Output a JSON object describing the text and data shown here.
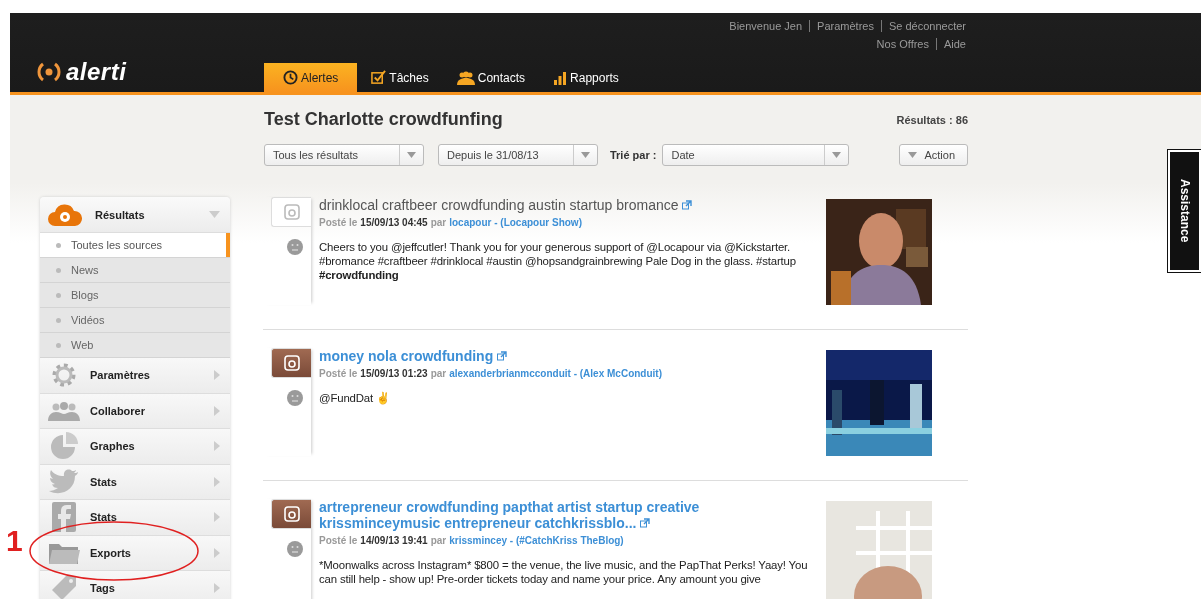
{
  "header": {
    "logo": "alerti",
    "user_links": [
      [
        "Bienvenue Jen",
        "Paramètres",
        "Se déconnecter"
      ],
      [
        "Nos Offres",
        "Aide"
      ]
    ],
    "tabs": [
      {
        "label": "Alertes",
        "selected": true
      },
      {
        "label": "Tâches",
        "selected": false
      },
      {
        "label": "Contacts",
        "selected": false
      },
      {
        "label": "Rapports",
        "selected": false
      }
    ]
  },
  "toolbar": {
    "title": "Test Charlotte crowdfunfing",
    "results": "Résultats : 86",
    "filters": [
      {
        "value": "Tous les résultats"
      },
      {
        "value": "Depuis le 31/08/13"
      }
    ],
    "sort_label": "Trié par :",
    "sort": {
      "value": "Date"
    },
    "action": "Action"
  },
  "sidebar": {
    "header": "Résultats",
    "sources": [
      {
        "label": "Toutes les sources",
        "selected": true
      },
      {
        "label": "News",
        "selected": false
      },
      {
        "label": "Blogs",
        "selected": false
      },
      {
        "label": "Vidéos",
        "selected": false
      },
      {
        "label": "Web",
        "selected": false
      }
    ],
    "items": [
      {
        "label": "Paramètres"
      },
      {
        "label": "Collaborer"
      },
      {
        "label": "Graphes"
      },
      {
        "label": "Stats"
      },
      {
        "label": "Stats"
      },
      {
        "label": "Exports"
      },
      {
        "label": "Tags"
      }
    ]
  },
  "posts": [
    {
      "title": "drinklocal craftbeer crowdfunding austin startup bromance",
      "read": true,
      "posted_label": "Posté le",
      "date": "15/09/13 04:45",
      "by_label": "par",
      "author": "locapour - (Locapour Show)",
      "body": [
        {
          "text": "Cheers to you @jeffcutler! Thank you for your generous support of @Locapour via @Kickstarter. #bromance #craftbeer #drinklocal #austin @hopsandgrainbrewing Pale Dog in the glass. #startup ",
          "bold": false
        },
        {
          "text": "#crowdfunding",
          "bold": true
        }
      ],
      "picture": {
        "kind": "picture"
      }
    },
    {
      "title": "money nola crowdfunding",
      "read": false,
      "posted_label": "Posté le",
      "date": "15/09/13 01:23",
      "by_label": "par",
      "author": "alexanderbrianmcconduit - (Alex McConduit)",
      "body": [
        {
          "text": "@FundDat ✌",
          "bold": false
        }
      ],
      "picture": {
        "kind": "picture"
      }
    },
    {
      "title": "artrepreneur crowdfunding papthat artist startup creative krissminceymusic entrepreneur catchkrissblo...",
      "read": false,
      "posted_label": "Posté le",
      "date": "14/09/13 19:41",
      "by_label": "par",
      "author": "krissmincey - (#CatchKriss TheBlog)",
      "body": [
        {
          "text": "*Moonwalks across Instagram* $800 = the venue, the live music, and the PapThat Perks! Yaay! You can still help - show up! Pre-order tickets today and name your price. Any amount you give",
          "bold": false
        }
      ],
      "picture": {
        "kind": "picture"
      }
    }
  ],
  "assistance_tab": "Assistance",
  "annotation": {
    "label": "1"
  }
}
